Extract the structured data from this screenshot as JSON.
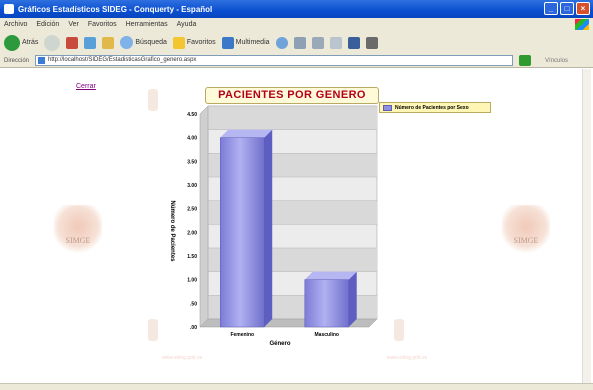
{
  "window": {
    "title": "Gráficos Estadísticos SIDEG - Conquerty - Español"
  },
  "menu": {
    "items": [
      "Archivo",
      "Edición",
      "Ver",
      "Favoritos",
      "Herramientas",
      "Ayuda"
    ]
  },
  "toolbar": {
    "back_label": "Atrás",
    "search_label": "Búsqueda",
    "favorites_label": "Favoritos",
    "media_label": "Multimedia"
  },
  "address": {
    "url": "http://localhost/SIDEG/EstadisticasGrafico_genero.aspx",
    "links_label": "Vínculos"
  },
  "page": {
    "back_link": "Cerrar",
    "logo_text": "SIMGE",
    "footer_left": "www.sideg.gob.ve",
    "footer_right": "www.sideg.gob.ve"
  },
  "colors": {
    "bar_fill": "#8f8fe6",
    "bar_dark": "#5e5ec2",
    "title_text": "#b3001b",
    "chart_bg": "#e6e6e6"
  },
  "chart_data": {
    "type": "bar",
    "title": "PACIENTES POR GENERO",
    "xlabel": "Género",
    "ylabel": "Número de Pacientes",
    "ylim": [
      0,
      4.5
    ],
    "yticks": [
      "4.50",
      "4.00",
      "3.50",
      "3.00",
      "2.50",
      "2.00",
      "1.50",
      "1.00",
      ".50",
      ".00"
    ],
    "categories": [
      "Femenino",
      "Masculino"
    ],
    "series": [
      {
        "name": "Número de Pacientes por Sexo",
        "values": [
          4,
          1
        ]
      }
    ],
    "legend_position": "right",
    "grid": true
  }
}
